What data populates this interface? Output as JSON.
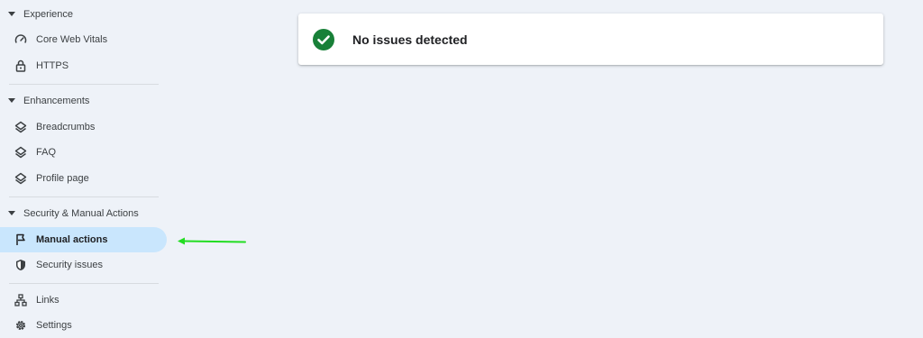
{
  "sidebar": {
    "sections": [
      {
        "header": "Experience",
        "items": [
          {
            "label": "Core Web Vitals",
            "icon": "gauge-icon"
          },
          {
            "label": "HTTPS",
            "icon": "lock-icon"
          }
        ]
      },
      {
        "header": "Enhancements",
        "items": [
          {
            "label": "Breadcrumbs",
            "icon": "layers-icon"
          },
          {
            "label": "FAQ",
            "icon": "layers-icon"
          },
          {
            "label": "Profile page",
            "icon": "layers-icon"
          }
        ]
      },
      {
        "header": "Security & Manual Actions",
        "items": [
          {
            "label": "Manual actions",
            "icon": "flag-icon",
            "active": true
          },
          {
            "label": "Security issues",
            "icon": "shield-icon"
          }
        ]
      }
    ],
    "bottom_items": [
      {
        "label": "Links",
        "icon": "sitemap-icon"
      },
      {
        "label": "Settings",
        "icon": "gear-icon"
      }
    ]
  },
  "status_card": {
    "message": "No issues detected",
    "icon": "check-circle-icon",
    "icon_color": "#188038"
  },
  "annotation": {
    "arrow_color": "#22dd22"
  },
  "colors": {
    "active_bg": "#c9e6fd",
    "page_bg": "#eef2f8"
  }
}
